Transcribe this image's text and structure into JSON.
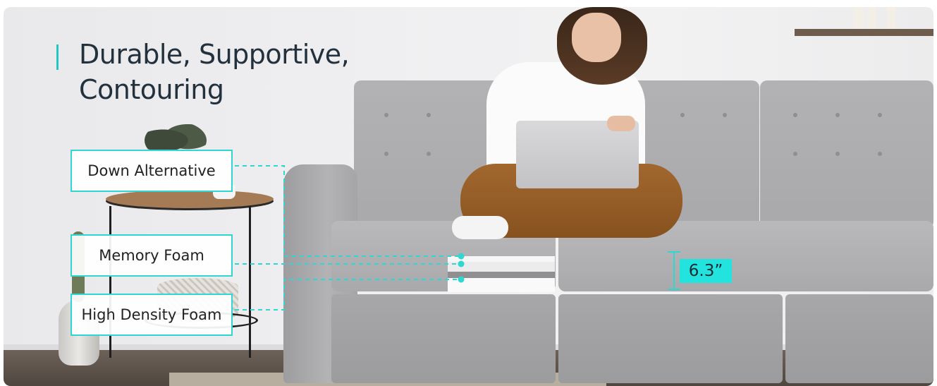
{
  "headline": {
    "line1": "Durable, Supportive,",
    "line2": "Contouring"
  },
  "layers": [
    {
      "label": "Down Alternative"
    },
    {
      "label": "Memory Foam"
    },
    {
      "label": "High Density Foam"
    }
  ],
  "measurement": {
    "label": "6.3”"
  },
  "colors": {
    "accent": "#21c7c3",
    "headline": "#23313d",
    "sofa": "#a9a9ab"
  }
}
